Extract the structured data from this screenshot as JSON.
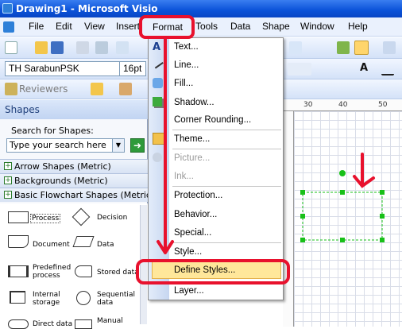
{
  "window": {
    "title": "Drawing1 - Microsoft Visio"
  },
  "menubar": {
    "items": [
      "File",
      "Edit",
      "View",
      "Insert",
      "Format",
      "Tools",
      "Data",
      "Shape",
      "Window",
      "Help"
    ]
  },
  "toolbar": {
    "font_name": "TH SarabunPSK",
    "font_size": "16pt",
    "reviewers": "Reviewers"
  },
  "shapes_panel": {
    "title": "Shapes",
    "search_label": "Search for Shapes:",
    "search_placeholder": "Type your search here",
    "stencils": [
      "Arrow Shapes (Metric)",
      "Backgrounds (Metric)",
      "Basic Flowchart Shapes (Metric)"
    ],
    "shapes": [
      "Process",
      "Decision",
      "Document",
      "Data",
      "Predefined process",
      "Stored data",
      "Internal storage",
      "Sequential data",
      "Direct data",
      "Manual"
    ]
  },
  "ruler": {
    "labels": [
      "30",
      "40",
      "50"
    ]
  },
  "format_menu": {
    "items": [
      {
        "label": "Text...",
        "enabled": true
      },
      {
        "label": "Line...",
        "enabled": true
      },
      {
        "label": "Fill...",
        "enabled": true
      },
      {
        "label": "Shadow...",
        "enabled": true
      },
      {
        "label": "Corner Rounding...",
        "enabled": true
      },
      {
        "label": "Theme...",
        "enabled": true
      },
      {
        "label": "Picture...",
        "enabled": false
      },
      {
        "label": "Ink...",
        "enabled": false
      },
      {
        "label": "Protection...",
        "enabled": true
      },
      {
        "label": "Behavior...",
        "enabled": true
      },
      {
        "label": "Special...",
        "enabled": true
      },
      {
        "label": "Style...",
        "enabled": true
      },
      {
        "label": "Define Styles...",
        "enabled": true,
        "highlighted": true
      },
      {
        "label": "Layer...",
        "enabled": true
      }
    ]
  },
  "colors": {
    "title_bar": "#0a52d8",
    "highlight": "#ffe79a",
    "annotation": "#e8112d",
    "selection": "#18c018"
  }
}
